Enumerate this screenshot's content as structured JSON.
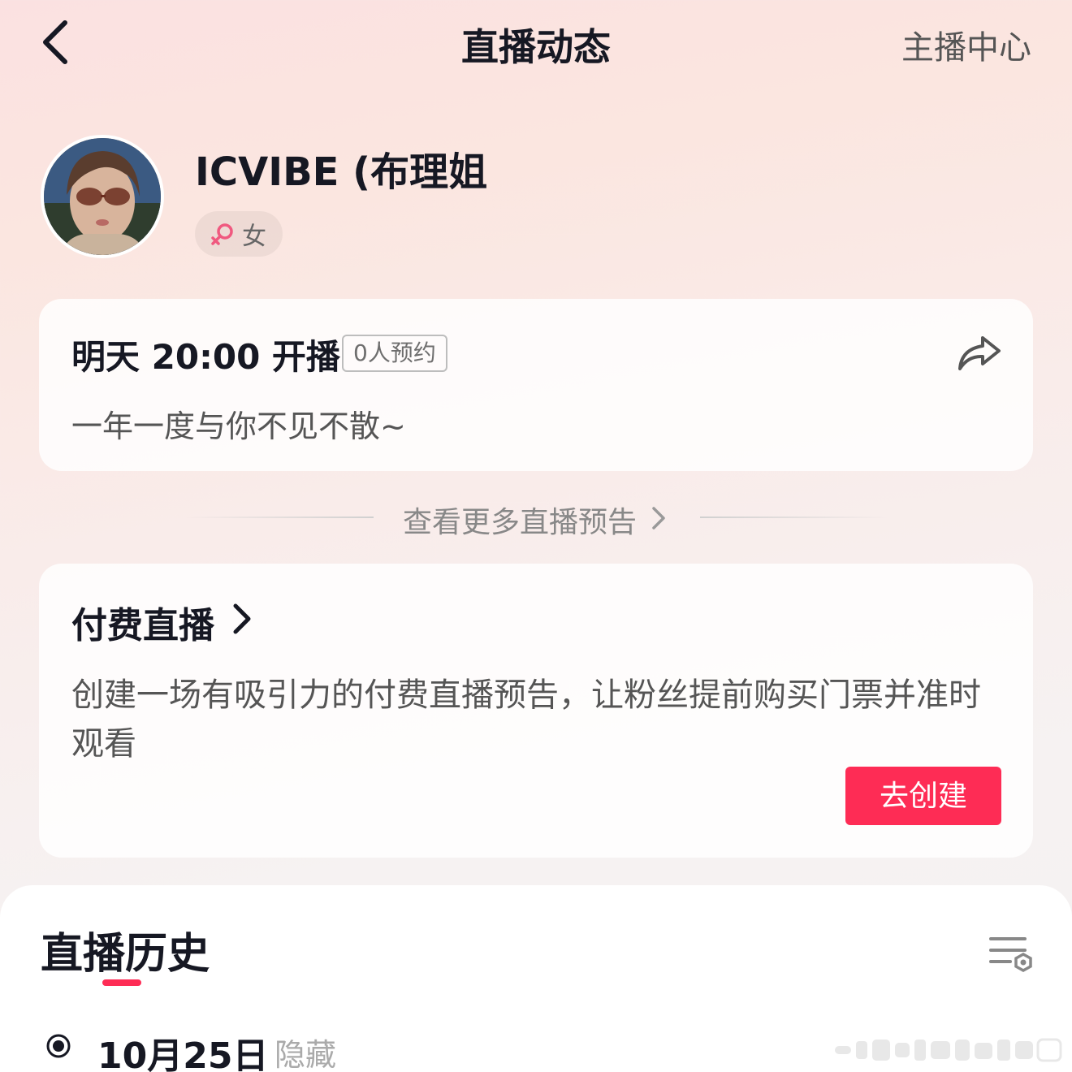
{
  "header": {
    "title": "直播动态",
    "right_link": "主播中心",
    "back_icon": "chevron-left-icon"
  },
  "profile": {
    "username": "ICVIBE (布理姐",
    "gender": "女",
    "gender_icon": "female-symbol-icon"
  },
  "schedule": {
    "time_text": "明天 20:00 开播",
    "reserve_count": "0人预约",
    "description": "一年一度与你不见不散~",
    "share_icon": "share-arrow-icon"
  },
  "more": {
    "label": "查看更多直播预告"
  },
  "paid_live": {
    "title": "付费直播",
    "description": "创建一场有吸引力的付费直播预告，让粉丝提前购买门票并准时观看",
    "button_label": "去创建"
  },
  "history": {
    "title": "直播历史",
    "filter_icon": "filter-settings-icon",
    "items": [
      {
        "date": "10月25日",
        "status": "隐藏"
      }
    ]
  },
  "colors": {
    "accent": "#fe2c55",
    "text_primary": "#161823",
    "text_secondary": "#555555"
  }
}
